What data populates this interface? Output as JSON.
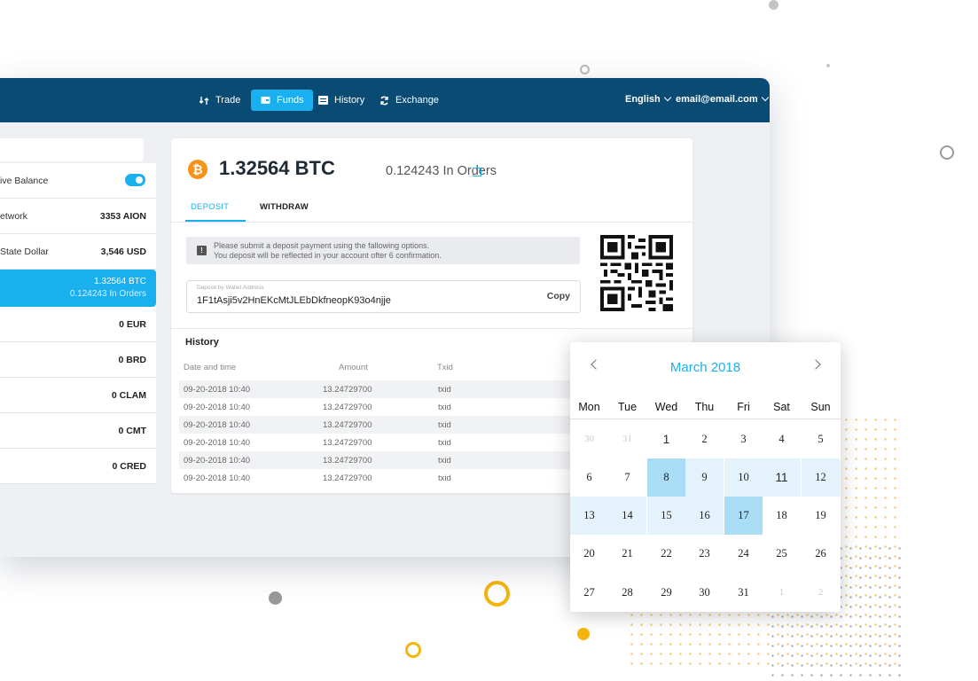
{
  "nav": {
    "trade": "Trade",
    "funds": "Funds",
    "history": "History",
    "exchange": "Exchange",
    "language": "English",
    "account": "email@email.com"
  },
  "sidebar": {
    "active_balance_label": "ive Balance",
    "active_balance_on": true,
    "items": [
      {
        "name": "etwork",
        "value": "3353 AION"
      },
      {
        "name": "State Dollar",
        "value": "3,546 USD"
      },
      {
        "name": "",
        "value": "1.32564 BTC",
        "sub": "0.124243 In Orders",
        "active": true
      },
      {
        "name": "",
        "value": "0 EUR"
      },
      {
        "name": "",
        "value": "0 BRD"
      },
      {
        "name": "",
        "value": "0 CLAM"
      },
      {
        "name": "",
        "value": "0 CMT"
      },
      {
        "name": "",
        "value": "0 CRED"
      }
    ]
  },
  "wallet": {
    "icon": "bitcoin-icon",
    "balance": "1.32564 BTC",
    "in_orders": "0.124243 In Orders",
    "tabs": [
      "DEPOSIT",
      "WITHDRAW"
    ],
    "notice_line1": "Please submit a deposit payment using the fallowing options.",
    "notice_line2": "You deposit will be reflected in your account ofter 6 confirmation.",
    "address_label": "Deposit by Wallet Address",
    "address": "1F1tAsji5v2HnEKcMtJLEbDkfneopK93o4njje",
    "copy": "Copy"
  },
  "history": {
    "title": "History",
    "headers": [
      "Date and time",
      "Amount",
      "Txid"
    ],
    "rows": [
      [
        "09-20-2018 10:40",
        "13.24729700",
        "txid"
      ],
      [
        "09-20-2018 10:40",
        "13.24729700",
        "txid"
      ],
      [
        "09-20-2018 10:40",
        "13.24729700",
        "txid"
      ],
      [
        "09-20-2018 10:40",
        "13.24729700",
        "txid"
      ],
      [
        "09-20-2018 10:40",
        "13.24729700",
        "txid"
      ],
      [
        "09-20-2018 10:40",
        "13.24729700",
        "txid"
      ]
    ]
  },
  "calendar": {
    "title": "March 2018",
    "dows": [
      "Mon",
      "Tue",
      "Wed",
      "Thu",
      "Fri",
      "Sat",
      "Sun"
    ],
    "weeks": [
      [
        "30",
        "31",
        "1",
        "2",
        "3",
        "4",
        "5"
      ],
      [
        "6",
        "7",
        "8",
        "9",
        "10",
        "11",
        "12"
      ],
      [
        "13",
        "14",
        "15",
        "16",
        "17",
        "18",
        "19"
      ],
      [
        "20",
        "21",
        "22",
        "23",
        "24",
        "25",
        "26"
      ],
      [
        "27",
        "28",
        "29",
        "30",
        "31",
        "1",
        "2"
      ]
    ],
    "selected": [
      "8",
      "17"
    ],
    "accent": "#1ab0f0"
  },
  "colors": {
    "topbar": "#0a4b73",
    "accent": "#1ab0f0",
    "bitcoin": "#f7931a"
  }
}
